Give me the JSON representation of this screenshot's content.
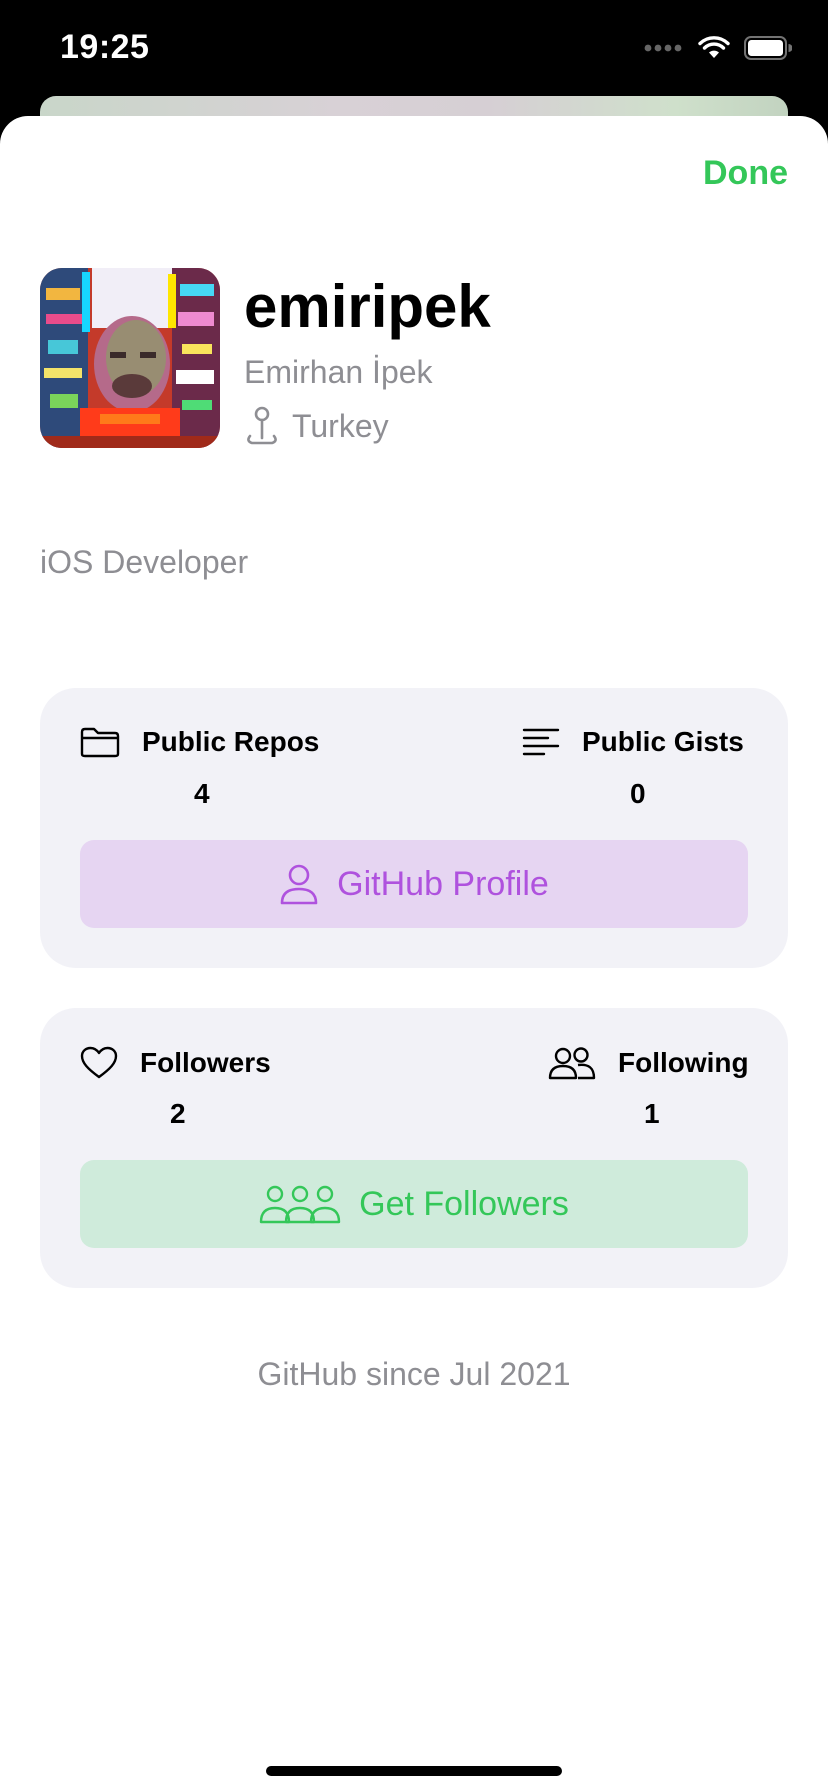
{
  "status_bar": {
    "time": "19:25"
  },
  "nav": {
    "done_label": "Done"
  },
  "profile": {
    "username": "emiripek",
    "full_name": "Emirhan İpek",
    "location": "Turkey",
    "bio": "iOS Developer"
  },
  "repos_card": {
    "repos_label": "Public Repos",
    "repos_value": "4",
    "gists_label": "Public Gists",
    "gists_value": "0",
    "button_label": "GitHub Profile"
  },
  "follow_card": {
    "followers_label": "Followers",
    "followers_value": "2",
    "following_label": "Following",
    "following_value": "1",
    "button_label": "Get Followers"
  },
  "footer": {
    "member_since": "GitHub since Jul 2021"
  },
  "colors": {
    "accent_green": "#34c759",
    "accent_purple": "#af52de",
    "secondary_text": "#8e8e93",
    "card_background": "#f2f2f7"
  }
}
